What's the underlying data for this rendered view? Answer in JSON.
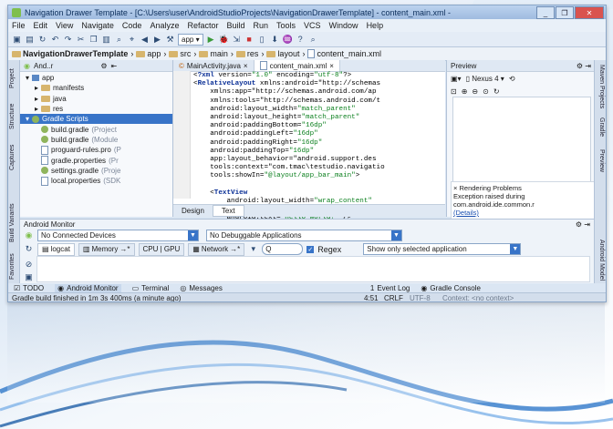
{
  "window": {
    "title": "Navigation Drawer Template - [C:\\Users\\user\\AndroidStudioProjects\\NavigationDrawerTemplate] - content_main.xml -",
    "minimize": "_",
    "maximize": "❐",
    "close": "✕"
  },
  "menu": [
    "File",
    "Edit",
    "View",
    "Navigate",
    "Code",
    "Analyze",
    "Refactor",
    "Build",
    "Run",
    "Tools",
    "VCS",
    "Window",
    "Help"
  ],
  "toolbar": {
    "run_config": "app"
  },
  "breadcrumb": [
    "NavigationDrawerTemplate",
    "app",
    "src",
    "main",
    "res",
    "layout",
    "content_main.xml"
  ],
  "side_tabs_left": [
    "Project",
    "Structure",
    "Captures",
    "Build Variants",
    "Favorites"
  ],
  "side_tabs_right": [
    "Maven Projects",
    "Gradle",
    "Preview",
    "Android Model"
  ],
  "project_panel": {
    "view": "And..r",
    "tree": [
      {
        "label": "app",
        "note": "",
        "indent": 1,
        "icon": "folder-icon"
      },
      {
        "label": "manifests",
        "note": "",
        "indent": 2,
        "icon": "folder-icon"
      },
      {
        "label": "java",
        "note": "",
        "indent": 2,
        "icon": "folder-icon"
      },
      {
        "label": "res",
        "note": "",
        "indent": 2,
        "icon": "folder-icon"
      },
      {
        "label": "Gradle Scripts",
        "note": "",
        "indent": 1,
        "icon": "gradle-icon",
        "selected": true
      },
      {
        "label": "build.gradle",
        "note": "(Project",
        "indent": 2,
        "icon": "gradle-icon"
      },
      {
        "label": "build.gradle",
        "note": "(Module",
        "indent": 2,
        "icon": "gradle-icon"
      },
      {
        "label": "proguard-rules.pro",
        "note": "(P",
        "indent": 2,
        "icon": "file-icon"
      },
      {
        "label": "gradle.properties",
        "note": "(Pr",
        "indent": 2,
        "icon": "file-icon"
      },
      {
        "label": "settings.gradle",
        "note": "(Proje",
        "indent": 2,
        "icon": "gradle-icon"
      },
      {
        "label": "local.properties",
        "note": "(SDK",
        "indent": 2,
        "icon": "file-icon"
      }
    ]
  },
  "editor": {
    "tabs": [
      {
        "label": "MainActivity.java",
        "active": false
      },
      {
        "label": "content_main.xml",
        "active": true
      }
    ],
    "code_lines": [
      [
        "<?xml version=\"1.0\" encoding=\"utf-8\"?>"
      ],
      [
        "<RelativeLayout xmlns:android=\"http://schemas"
      ],
      [
        "    xmlns:app=\"http://schemas.android.com/ap"
      ],
      [
        "    xmlns:tools=\"http://schemas.android.com/t"
      ],
      [
        "    android:layout_width=\"match_parent\""
      ],
      [
        "    android:layout_height=\"match_parent\""
      ],
      [
        "    android:paddingBottom=\"16dp\""
      ],
      [
        "    android:paddingLeft=\"16dp\""
      ],
      [
        "    android:paddingRight=\"16dp\""
      ],
      [
        "    android:paddingTop=\"16dp\""
      ],
      [
        "    app:layout_behavior=\"android.support.des"
      ],
      [
        "    tools:context=\"com.tmac\\testudio.navigatio"
      ],
      [
        "    tools:showIn=\"@layout/app_bar_main\">"
      ],
      [
        ""
      ],
      [
        "    <TextView"
      ],
      [
        "        android:layout_width=\"wrap_content\""
      ],
      [
        "        android:layout_height=\"wrap_content\""
      ],
      [
        "        android:text=\"Hello World!\" />"
      ],
      [
        "</RelativeLayout>"
      ]
    ],
    "bottom_tabs": [
      {
        "label": "Design",
        "active": false
      },
      {
        "label": "Text",
        "active": true
      }
    ]
  },
  "preview": {
    "title": "Preview",
    "device": "Nexus 4",
    "render_problem_title": "Rendering Problems",
    "render_problem_text": "Exception raised during",
    "render_problem_text2": "com.android.ide.common.r",
    "details_link": "(Details)"
  },
  "monitor": {
    "title": "Android Monitor",
    "device_combo": "No Connected Devices",
    "app_combo": "No Debuggable Applications",
    "tabs": [
      "logcat",
      "Memory",
      "CPU | GPU",
      "Network"
    ],
    "search_placeholder": "Q",
    "regex_label": "Regex",
    "filter_combo": "Show only selected application"
  },
  "bottom_tool_tabs": [
    {
      "label": "TODO",
      "active": false
    },
    {
      "label": "Android Monitor",
      "active": true
    },
    {
      "label": "Terminal",
      "active": false
    },
    {
      "label": "Messages",
      "active": false
    },
    {
      "label": "Event Log",
      "active": false
    },
    {
      "label": "Gradle Console",
      "active": false
    }
  ],
  "status": {
    "message": "Gradle build finished in 1m 3s 400ms (a minute ago)",
    "position": "4:51",
    "line_sep": "CRLF",
    "encoding": "UTF-8",
    "context": "Context: <no context>"
  },
  "colors": {
    "accent": "#3874c8",
    "gradle_green": "#8fb45c",
    "folder": "#d7b56d"
  }
}
